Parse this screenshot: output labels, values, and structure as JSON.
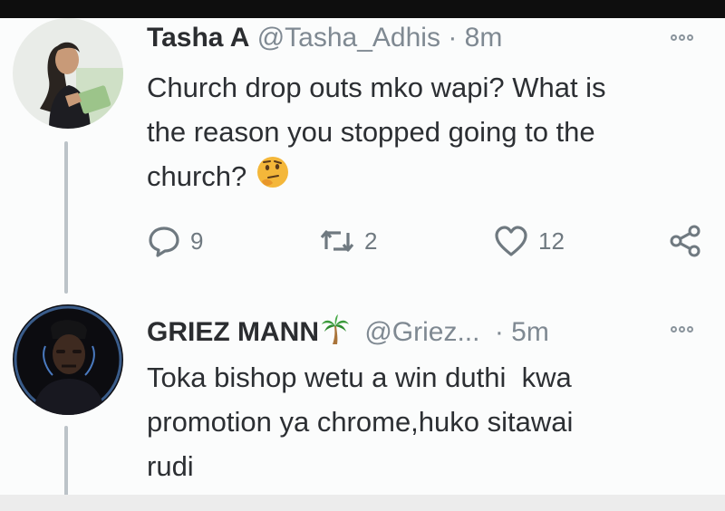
{
  "tweets": [
    {
      "name": "Tasha A",
      "handle": "@Tasha_Adhis",
      "separator": "·",
      "time": "8m",
      "lines": [
        "Church drop outs mko wapi? What is",
        "the reason you stopped going to the",
        "church?"
      ],
      "emoji": "thinking-face",
      "actions": {
        "replies": "9",
        "retweets": "2",
        "likes": "12"
      }
    },
    {
      "name": "GRIEZ MANN",
      "name_emoji": "palm-tree",
      "handle": "@Griez...",
      "separator": "·",
      "time": "5m",
      "lines": [
        "Toka bishop wetu a win duthi  kwa",
        "promotion ya chrome,huko sitawai",
        "rudi"
      ]
    }
  ],
  "icons": {
    "reply": "reply-icon",
    "retweet": "retweet-icon",
    "like": "heart-icon",
    "share": "share-icon",
    "more": "more-icon"
  },
  "colors": {
    "text": "#2c2f33",
    "muted": "#7f8992",
    "thread": "#bcc3c8"
  }
}
